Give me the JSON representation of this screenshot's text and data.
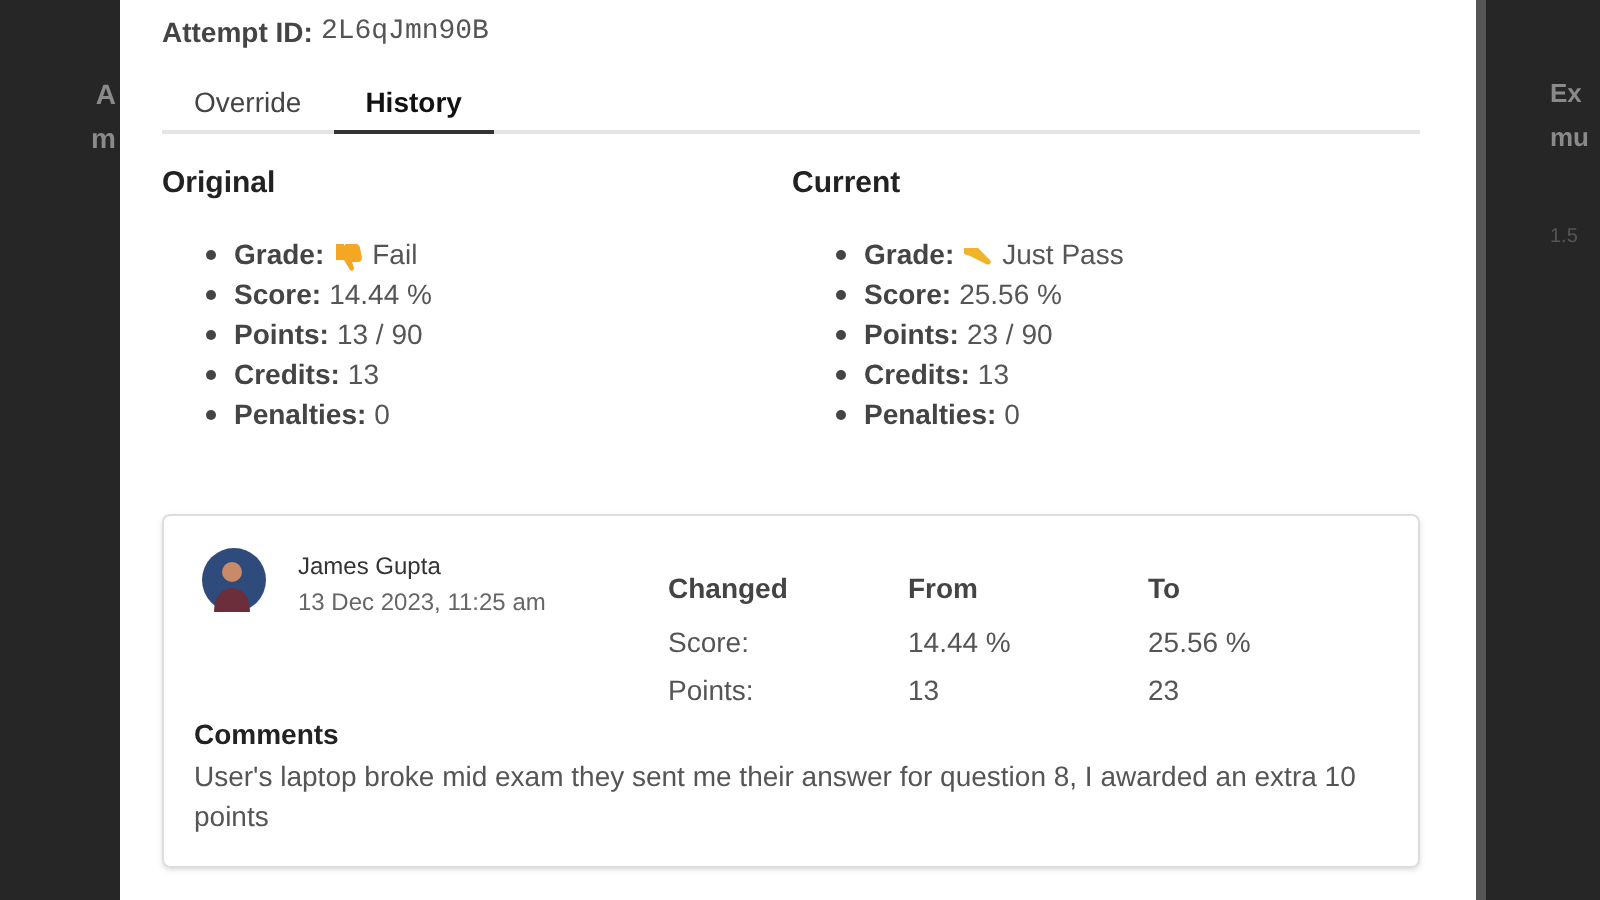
{
  "background": {
    "left_fragments": [
      "A",
      "m"
    ],
    "right_fragments": [
      "Ex",
      "mu"
    ],
    "right_cell": "1.5"
  },
  "attempt": {
    "label": "Attempt ID:",
    "value": "2L6qJmn90B"
  },
  "tabs": [
    {
      "label": "Override",
      "selected": false
    },
    {
      "label": "History",
      "selected": true
    }
  ],
  "columns": [
    {
      "title": "Original",
      "items": [
        {
          "label": "Grade:",
          "value": "Fail",
          "kind": "fail"
        },
        {
          "label": "Score:",
          "value": "14.44 %"
        },
        {
          "label": "Points:",
          "value": "13 / 90"
        },
        {
          "label": "Credits:",
          "value": "13"
        },
        {
          "label": "Penalties:",
          "value": "0"
        }
      ]
    },
    {
      "title": "Current",
      "items": [
        {
          "label": "Grade:",
          "value": "Just Pass",
          "kind": "just_pass"
        },
        {
          "label": "Score:",
          "value": "25.56 %"
        },
        {
          "label": "Points:",
          "value": "23 / 90"
        },
        {
          "label": "Credits:",
          "value": "13"
        },
        {
          "label": "Penalties:",
          "value": "0"
        }
      ]
    }
  ],
  "change": {
    "user": "James Gupta",
    "date": "13 Dec 2023, 11:25 am",
    "headers": [
      "Changed",
      "From",
      "To"
    ],
    "rows": [
      [
        "Score:",
        "14.44 %",
        "25.56 %"
      ],
      [
        "Points:",
        "13",
        "23"
      ]
    ],
    "comments_title": "Comments",
    "comment": "User's laptop broke mid exam they sent me their answer for question 8, I awarded an extra 10 points"
  }
}
